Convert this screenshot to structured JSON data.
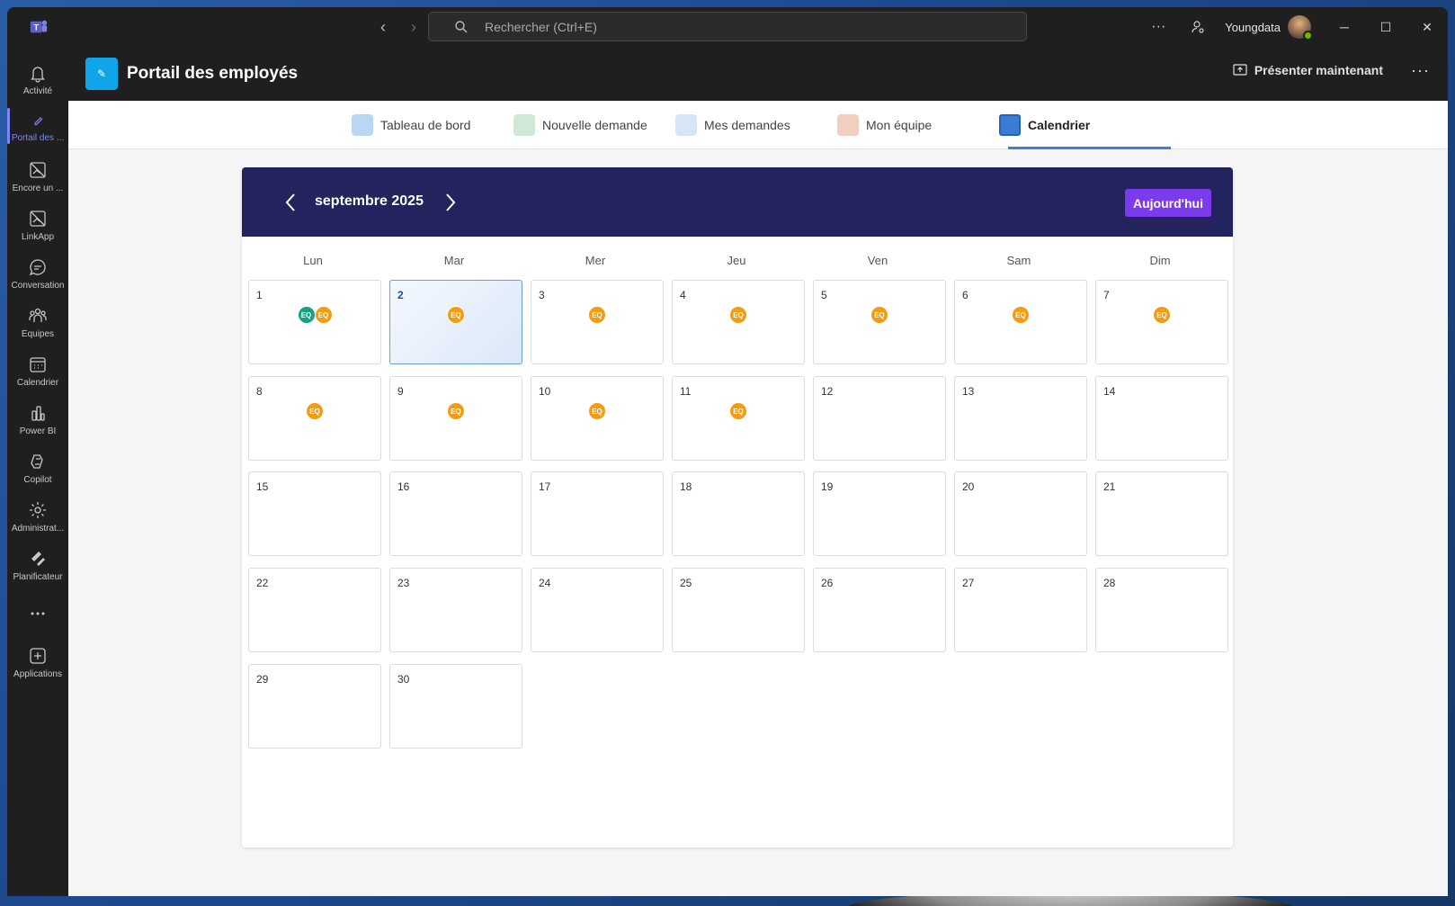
{
  "window": {
    "search_placeholder": "Rechercher (Ctrl+E)",
    "username": "Youngdata",
    "more": "···"
  },
  "rail": [
    {
      "label": "Activité",
      "icon": "bell-icon"
    },
    {
      "label": "Portail des ...",
      "icon": "pencil-icon",
      "active": true
    },
    {
      "label": "Encore un ...",
      "icon": "broken-image-icon"
    },
    {
      "label": "LinkApp",
      "icon": "broken-image-icon"
    },
    {
      "label": "Conversation",
      "icon": "chat-icon"
    },
    {
      "label": "Équipes",
      "icon": "teams-icon"
    },
    {
      "label": "Calendrier",
      "icon": "calendar-icon"
    },
    {
      "label": "Power BI",
      "icon": "powerbi-icon"
    },
    {
      "label": "Copilot",
      "icon": "copilot-icon"
    },
    {
      "label": "Administrat...",
      "icon": "admin-icon"
    },
    {
      "label": "Planificateur",
      "icon": "planner-icon"
    },
    {
      "label": "",
      "icon": "more-icon"
    },
    {
      "label": "Applications",
      "icon": "add-app-icon"
    }
  ],
  "app": {
    "title": "Portail des employés",
    "present_label": "Présenter maintenant"
  },
  "tabs": [
    {
      "label": "Tableau de bord",
      "color": "#b9d7f2"
    },
    {
      "label": "Nouvelle demande",
      "color": "#cfe8d8"
    },
    {
      "label": "Mes demandes",
      "color": "#d7e6f6"
    },
    {
      "label": "Mon équipe",
      "color": "#f1cfc0"
    },
    {
      "label": "Calendrier",
      "color": "#3a7bd5",
      "active": true
    }
  ],
  "calendar": {
    "month_label": "septembre 2025",
    "today_label": "Aujourd'hui",
    "today": 2,
    "weekdays": [
      "Lun",
      "Mar",
      "Mer",
      "Jeu",
      "Ven",
      "Sam",
      "Dim"
    ],
    "badge_colors": {
      "green": "#16a085",
      "orange": "#f39c12"
    },
    "days": [
      {
        "n": "1",
        "badges": [
          {
            "t": "EQ",
            "c": "green"
          },
          {
            "t": "EQ",
            "c": "orange"
          }
        ]
      },
      {
        "n": "2",
        "badges": [
          {
            "t": "EQ",
            "c": "orange"
          }
        ]
      },
      {
        "n": "3",
        "badges": [
          {
            "t": "EQ",
            "c": "orange"
          }
        ]
      },
      {
        "n": "4",
        "badges": [
          {
            "t": "EQ",
            "c": "orange"
          }
        ]
      },
      {
        "n": "5",
        "badges": [
          {
            "t": "EQ",
            "c": "orange"
          }
        ]
      },
      {
        "n": "6",
        "badges": [
          {
            "t": "EQ",
            "c": "orange"
          }
        ]
      },
      {
        "n": "7",
        "badges": [
          {
            "t": "EQ",
            "c": "orange"
          }
        ]
      },
      {
        "n": "8",
        "badges": [
          {
            "t": "EQ",
            "c": "orange"
          }
        ]
      },
      {
        "n": "9",
        "badges": [
          {
            "t": "EQ",
            "c": "orange"
          }
        ]
      },
      {
        "n": "10",
        "badges": [
          {
            "t": "EQ",
            "c": "orange"
          }
        ]
      },
      {
        "n": "11",
        "badges": [
          {
            "t": "EQ",
            "c": "orange"
          }
        ]
      },
      {
        "n": "12",
        "badges": []
      },
      {
        "n": "13",
        "badges": []
      },
      {
        "n": "14",
        "badges": []
      },
      {
        "n": "15",
        "badges": []
      },
      {
        "n": "16",
        "badges": []
      },
      {
        "n": "17",
        "badges": []
      },
      {
        "n": "18",
        "badges": []
      },
      {
        "n": "19",
        "badges": []
      },
      {
        "n": "20",
        "badges": []
      },
      {
        "n": "21",
        "badges": []
      },
      {
        "n": "22",
        "badges": []
      },
      {
        "n": "23",
        "badges": []
      },
      {
        "n": "24",
        "badges": []
      },
      {
        "n": "25",
        "badges": []
      },
      {
        "n": "26",
        "badges": []
      },
      {
        "n": "27",
        "badges": []
      },
      {
        "n": "28",
        "badges": []
      },
      {
        "n": "29",
        "badges": []
      },
      {
        "n": "30",
        "badges": []
      }
    ]
  }
}
